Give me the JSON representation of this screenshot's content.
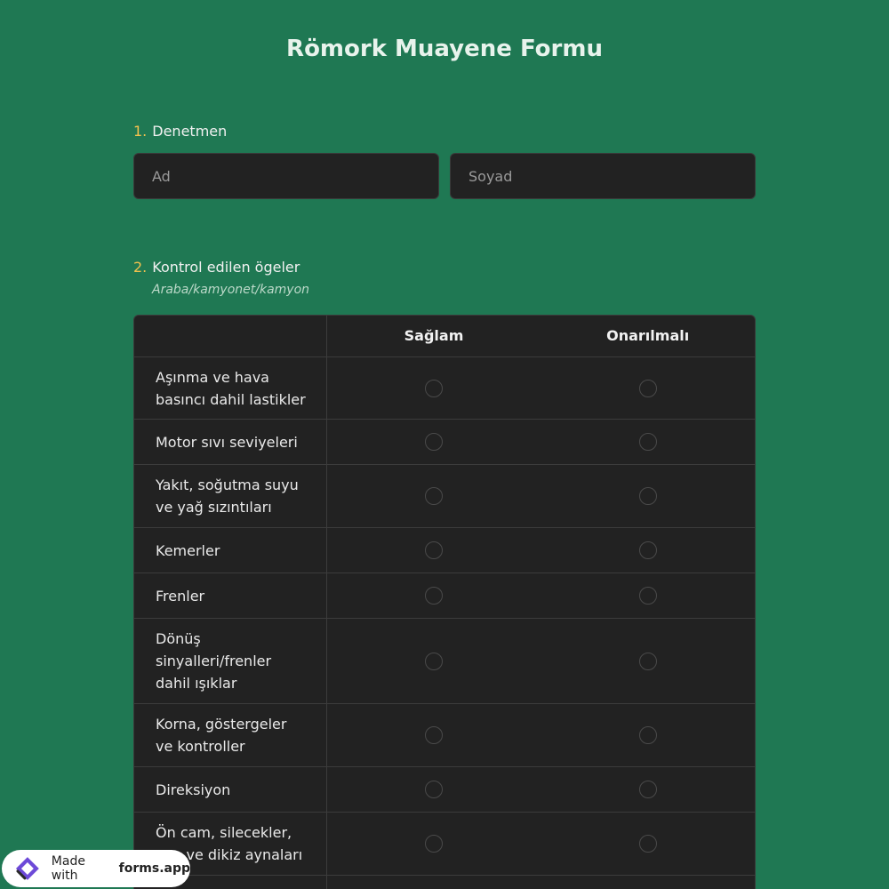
{
  "form": {
    "title": "Römork Muayene Formu"
  },
  "q1": {
    "number": "1.",
    "label": "Denetmen",
    "first_placeholder": "Ad",
    "last_placeholder": "Soyad"
  },
  "q2": {
    "number": "2.",
    "label": "Kontrol edilen ögeler",
    "description": "Araba/kamyonet/kamyon",
    "columns": [
      "Sağlam",
      "Onarılmalı"
    ],
    "rows": [
      "Aşınma ve hava basıncı dahil lastikler",
      "Motor sıvı seviyeleri",
      "Yakıt, soğutma suyu ve yağ sızıntıları",
      "Kemerler",
      "Frenler",
      "Dönüş sinyalleri/frenler dahil ışıklar",
      "Korna, göstergeler ve kontroller",
      "Direksiyon",
      "Ön cam, silecekler, yan ve dikiz aynaları",
      ""
    ]
  },
  "badge": {
    "prefix": "Made with",
    "brand": "forms.app"
  },
  "colors": {
    "background": "#1f7853",
    "panel": "#222222",
    "accent_number": "#f2c14e"
  }
}
